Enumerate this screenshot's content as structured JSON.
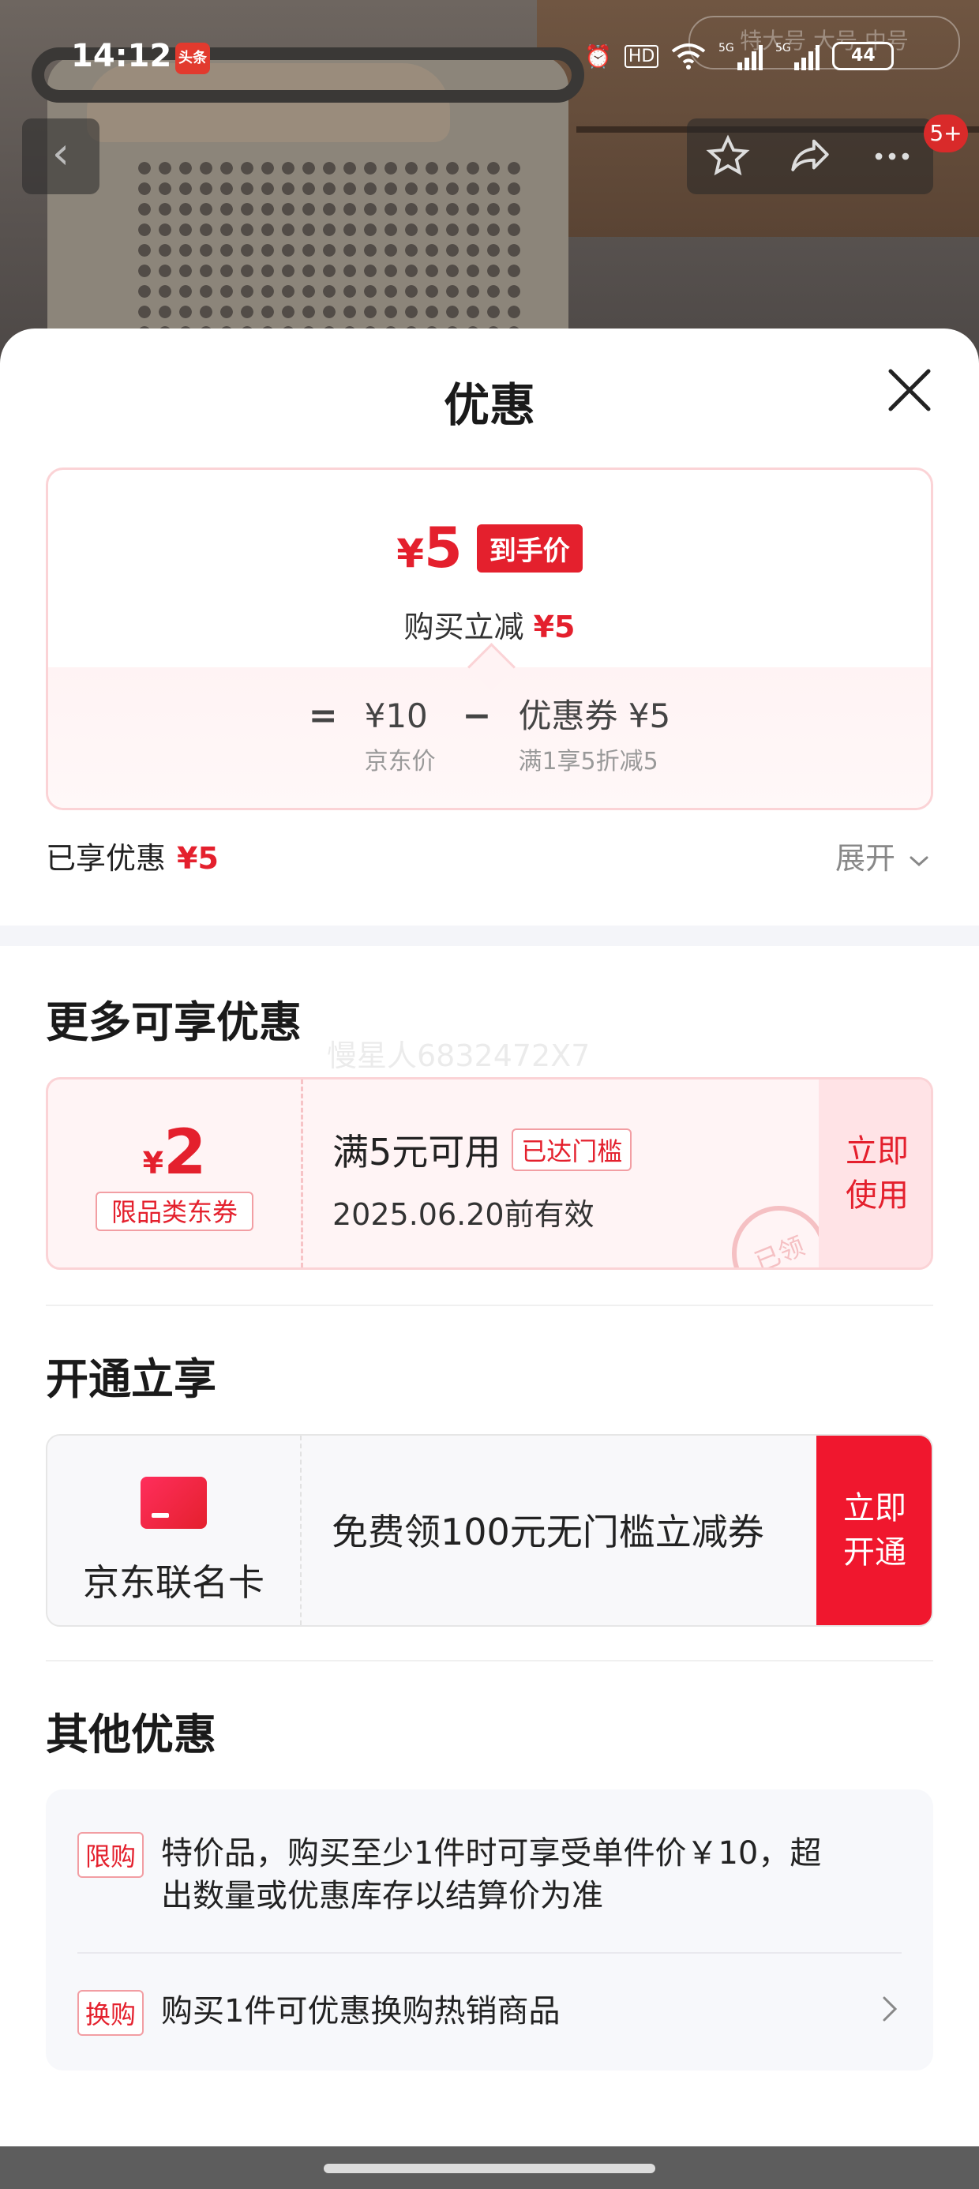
{
  "status_bar": {
    "time": "14:12",
    "news_badge": "头条",
    "battery": "44",
    "size_chip": "特大号 大号 中号"
  },
  "nav": {
    "notify_badge": "5+"
  },
  "sheet": {
    "title": "优惠",
    "price_card": {
      "currency": "¥",
      "final_price": "5",
      "final_tag": "到手价",
      "reduce_label": "购买立减",
      "reduce_value": "¥5",
      "equals": "=",
      "minus": "−",
      "jd_price": "¥10",
      "jd_price_label": "京东价",
      "coupon_value": "优惠券 ¥5",
      "coupon_rule": "满1享5折减5"
    },
    "enjoyed": {
      "label": "已享优惠",
      "value": "¥5",
      "expand": "展开"
    },
    "more": {
      "title": "更多可享优惠",
      "watermark": "慢星人6832472X7",
      "coupon": {
        "currency": "¥",
        "amount": "2",
        "kind": "限品类东券",
        "condition": "满5元可用",
        "status": "已达门槛",
        "valid": "2025.06.20前有效",
        "stamp": "已领",
        "button": "立即\n使用"
      }
    },
    "open": {
      "title": "开通立享",
      "card_name": "京东联名卡",
      "offer": "免费领100元无门槛立减券",
      "button": "立即\n开通"
    },
    "other": {
      "title": "其他优惠",
      "items": [
        {
          "tag": "限购",
          "text": "特价品，购买至少1件时可享受单件价￥10，超出数量或优惠库存以结算价为准"
        },
        {
          "tag": "换购",
          "text": "购买1件可优惠换购热销商品"
        }
      ]
    }
  },
  "colors": {
    "accent": "#e4202d",
    "accent_light": "#fff4f5",
    "border_pink": "#fbd3d6"
  }
}
